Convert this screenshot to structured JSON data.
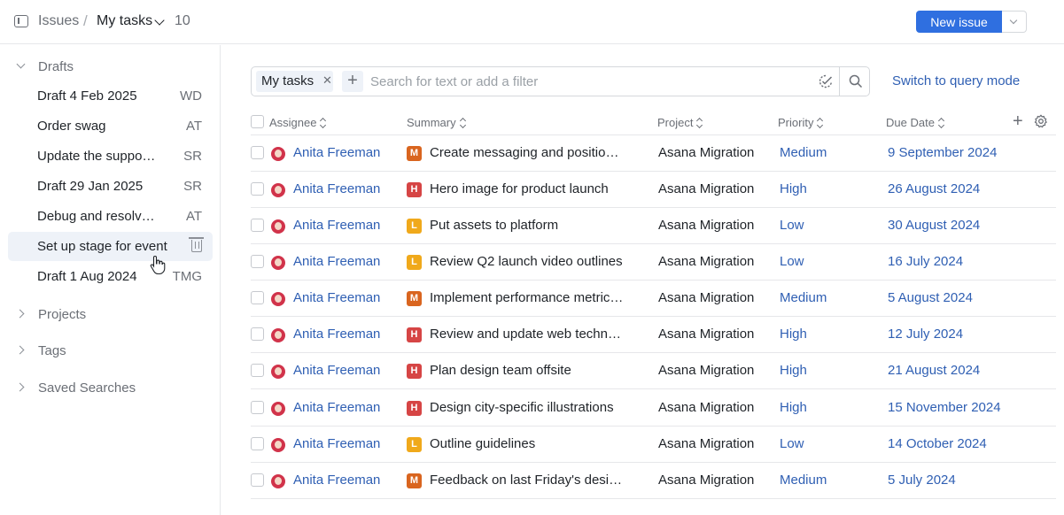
{
  "topbar": {
    "breadcrumb_root": "Issues",
    "breadcrumb_sep": "/",
    "breadcrumb_current": "My tasks",
    "count": "10",
    "new_issue_label": "New issue"
  },
  "sidebar": {
    "drafts_label": "Drafts",
    "drafts": [
      {
        "label": "Draft 4 Feb 2025",
        "initials": "WD"
      },
      {
        "label": "Order swag",
        "initials": "AT"
      },
      {
        "label": "Update the suppo…",
        "initials": "SR"
      },
      {
        "label": "Draft 29 Jan 2025",
        "initials": "SR"
      },
      {
        "label": "Debug and resolv…",
        "initials": "AT"
      },
      {
        "label": "Set up stage for event",
        "initials": ""
      },
      {
        "label": "Draft 1 Aug 2024",
        "initials": "TMG"
      }
    ],
    "projects_label": "Projects",
    "tags_label": "Tags",
    "saved_searches_label": "Saved Searches"
  },
  "search": {
    "chip_label": "My tasks",
    "placeholder": "Search for text or add a filter",
    "query_mode_label": "Switch to query mode"
  },
  "table": {
    "columns": {
      "assignee": "Assignee",
      "summary": "Summary",
      "project": "Project",
      "priority": "Priority",
      "due": "Due Date"
    },
    "priority_colors": {
      "M": "#d9651f",
      "H": "#d64545",
      "L": "#f0a91b"
    },
    "rows": [
      {
        "assignee": "Anita Freeman",
        "badge": "M",
        "summary": "Create messaging and positio…",
        "project": "Asana Migration",
        "priority": "Medium",
        "due": "9 September 2024"
      },
      {
        "assignee": "Anita Freeman",
        "badge": "H",
        "summary": "Hero image for product launch",
        "project": "Asana Migration",
        "priority": "High",
        "due": "26 August 2024"
      },
      {
        "assignee": "Anita Freeman",
        "badge": "L",
        "summary": "Put assets to platform",
        "project": "Asana Migration",
        "priority": "Low",
        "due": "30 August 2024"
      },
      {
        "assignee": "Anita Freeman",
        "badge": "L",
        "summary": "Review Q2 launch video outlines",
        "project": "Asana Migration",
        "priority": "Low",
        "due": "16 July 2024"
      },
      {
        "assignee": "Anita Freeman",
        "badge": "M",
        "summary": "Implement performance metric…",
        "project": "Asana Migration",
        "priority": "Medium",
        "due": "5 August 2024"
      },
      {
        "assignee": "Anita Freeman",
        "badge": "H",
        "summary": "Review and update web techn…",
        "project": "Asana Migration",
        "priority": "High",
        "due": "12 July 2024"
      },
      {
        "assignee": "Anita Freeman",
        "badge": "H",
        "summary": "Plan design team offsite",
        "project": "Asana Migration",
        "priority": "High",
        "due": "21 August 2024"
      },
      {
        "assignee": "Anita Freeman",
        "badge": "H",
        "summary": "Design city-specific illustrations",
        "project": "Asana Migration",
        "priority": "High",
        "due": "15 November 2024"
      },
      {
        "assignee": "Anita Freeman",
        "badge": "L",
        "summary": "Outline guidelines",
        "project": "Asana Migration",
        "priority": "Low",
        "due": "14 October 2024"
      },
      {
        "assignee": "Anita Freeman",
        "badge": "M",
        "summary": "Feedback on last Friday's desi…",
        "project": "Asana Migration",
        "priority": "Medium",
        "due": "5 July 2024"
      }
    ]
  }
}
